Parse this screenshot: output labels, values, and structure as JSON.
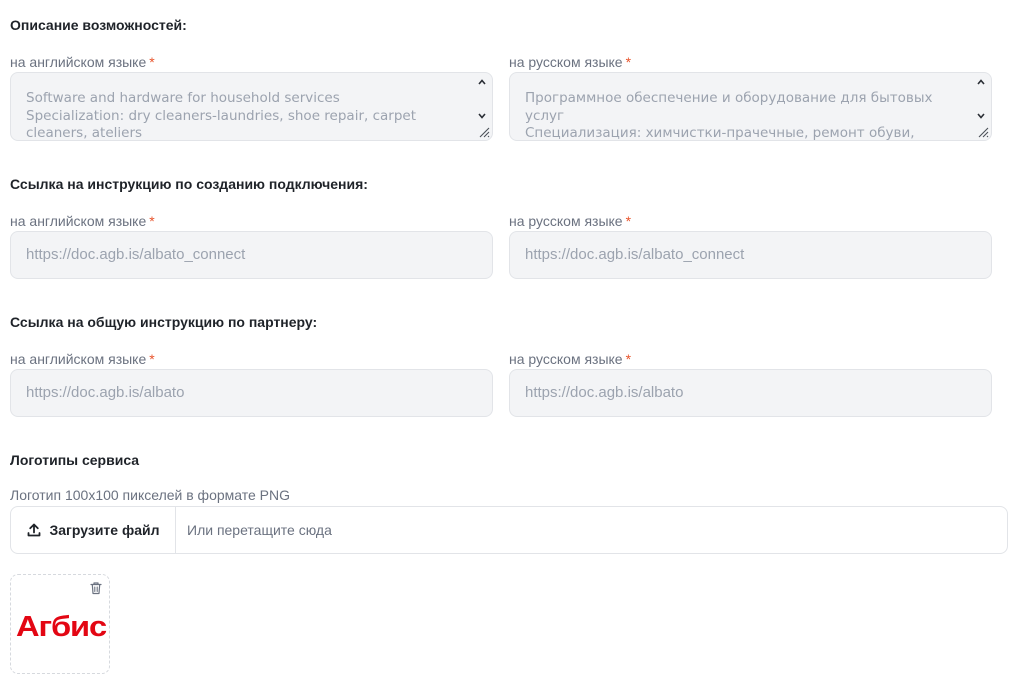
{
  "description_section": {
    "title": "Описание возможностей:",
    "en": {
      "label": "на английском языке",
      "value": "Software and hardware for household services\nSpecialization: dry cleaners-laundries, shoe repair, carpet cleaners, ateliers"
    },
    "ru": {
      "label": "на русском языке",
      "value": "Программное обеспечение и оборудование для бытовых услуг\nСпециализация: химчистки-прачечные, ремонт обуви,"
    }
  },
  "connect_link_section": {
    "title": "Ссылка на инструкцию по созданию подключения:",
    "en": {
      "label": "на английском языке",
      "value": "https://doc.agb.is/albato_connect"
    },
    "ru": {
      "label": "на русском языке",
      "value": "https://doc.agb.is/albato_connect"
    }
  },
  "partner_link_section": {
    "title": "Ссылка на общую инструкцию по партнеру:",
    "en": {
      "label": "на английском языке",
      "value": "https://doc.agb.is/albato"
    },
    "ru": {
      "label": "на русском языке",
      "value": "https://doc.agb.is/albato"
    }
  },
  "logos_section": {
    "title": "Логотипы сервиса",
    "hint": "Логотип 100x100 пикселей в формате PNG",
    "upload_button_label": "Загрузите файл",
    "drop_text": "Или перетащите сюда",
    "logo_text": "Агбис",
    "logo_color": "#e30613"
  },
  "required_mark": "*",
  "icons": {
    "upload": "upload-icon",
    "trash": "trash-icon",
    "spinner_up": "chevron-up-icon",
    "spinner_down": "chevron-down-icon",
    "resize": "resize-grip-icon"
  }
}
